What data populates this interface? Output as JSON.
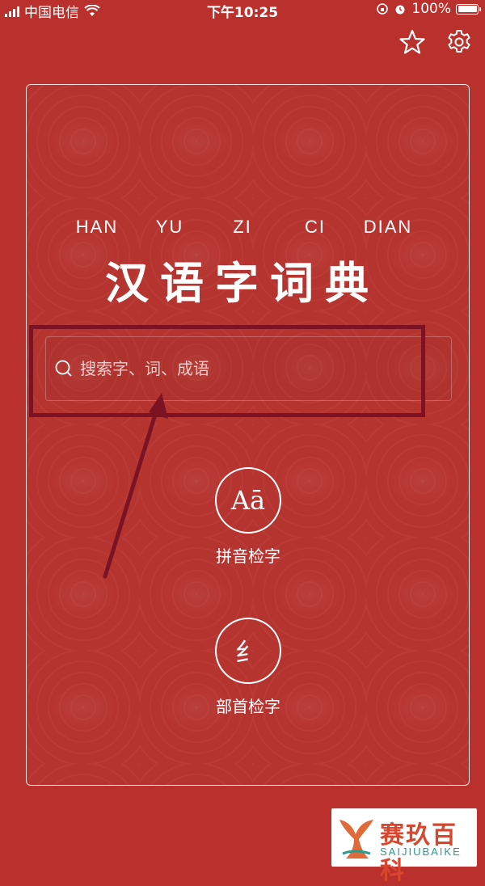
{
  "status_bar": {
    "carrier": "中国电信",
    "time": "下午10:25",
    "battery": "100%",
    "battery_level": 1.0
  },
  "header": {
    "favorites_icon": "star-icon",
    "settings_icon": "gear-icon"
  },
  "brand": {
    "pinyin": [
      "HAN",
      "YU",
      "ZI",
      "CI",
      "DIAN"
    ],
    "title": "汉语字词典"
  },
  "search": {
    "placeholder": "搜索字、词、成语",
    "value": ""
  },
  "features": {
    "pinyin_lookup": {
      "icon_text": "Aā",
      "label": "拼音检字"
    },
    "radical_lookup": {
      "icon_text": "纟",
      "label": "部首检字"
    }
  },
  "watermark": {
    "name": "赛玖百科",
    "sub": "SAIJIUBAIKE"
  },
  "colors": {
    "background": "#b9302c",
    "annotation": "#7b1324",
    "watermark_red": "#d8462e",
    "watermark_teal": "#2b9a8e"
  }
}
